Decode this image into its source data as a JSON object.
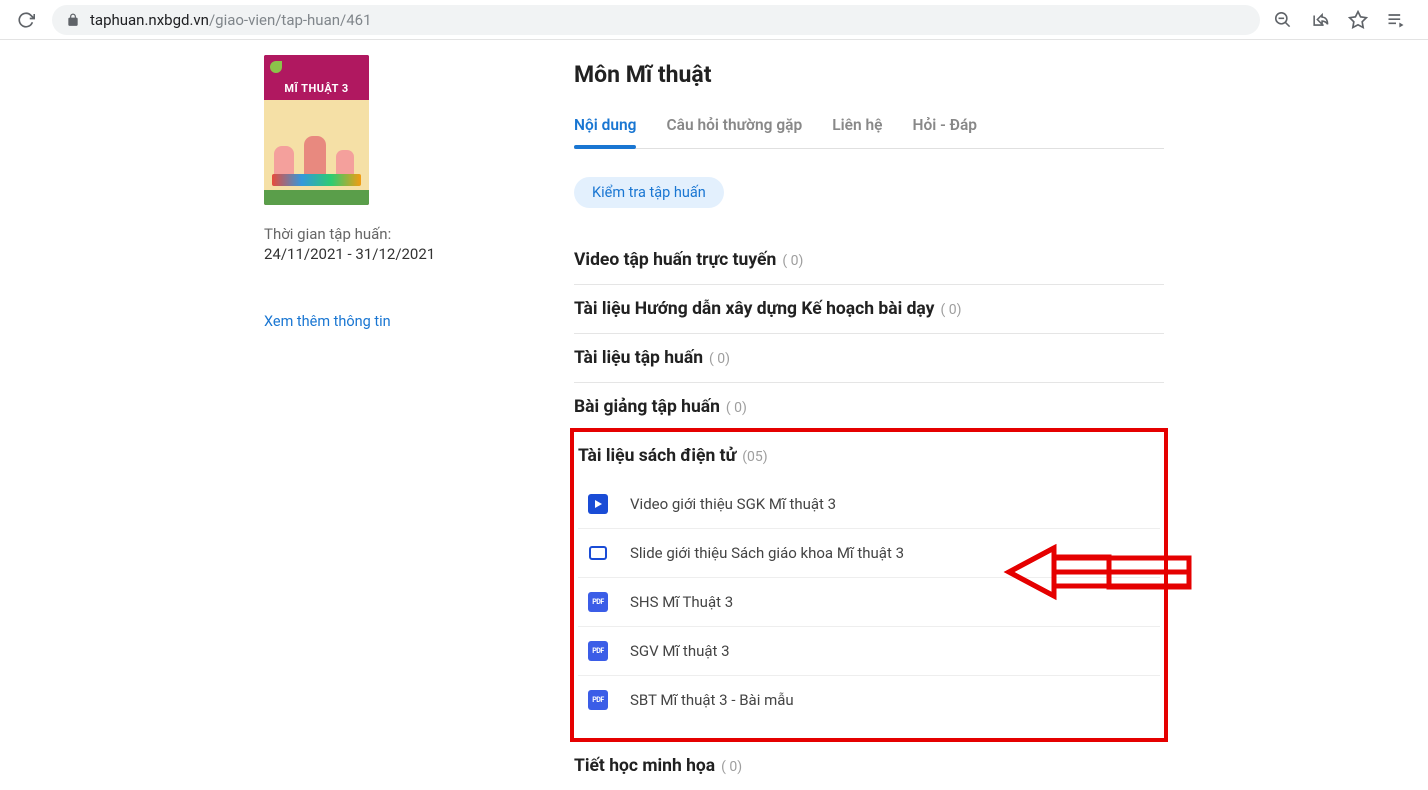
{
  "browser": {
    "url_domain": "taphuan.nxbgd.vn",
    "url_path": "/giao-vien/tap-huan/461"
  },
  "sidebar": {
    "book_title": "MĨ THUẬT 3",
    "time_label": "Thời gian tập huấn:",
    "time_value": "24/11/2021 - 31/12/2021",
    "more_link": "Xem thêm thông tin"
  },
  "main": {
    "title": "Môn Mĩ thuật",
    "tabs": {
      "content": "Nội dung",
      "faq": "Câu hỏi thường gặp",
      "contact": "Liên hệ",
      "qa": "Hỏi - Đáp"
    },
    "chip": "Kiểm tra tập huấn",
    "sections": {
      "video_online": {
        "title": "Video tập huấn trực tuyến",
        "count": "( 0)"
      },
      "doc_plan": {
        "title": "Tài liệu Hướng dẫn xây dựng Kế hoạch bài dạy",
        "count": "( 0)"
      },
      "doc_training": {
        "title": "Tài liệu tập huấn",
        "count": "( 0)"
      },
      "lecture": {
        "title": "Bài giảng tập huấn",
        "count": "( 0)"
      },
      "ebook": {
        "title": "Tài liệu sách điện tử",
        "count": "(05)"
      },
      "demo": {
        "title": "Tiết học minh họa",
        "count": "( 0)"
      }
    },
    "ebook_items": {
      "i1": "Video giới thiệu SGK Mĩ thuật 3",
      "i2": "Slide giới thiệu Sách giáo khoa Mĩ thuật 3",
      "i3": "SHS Mĩ Thuật 3",
      "i4": "SGV Mĩ thuật 3",
      "i5": "SBT Mĩ thuật 3 - Bài mẫu"
    }
  }
}
